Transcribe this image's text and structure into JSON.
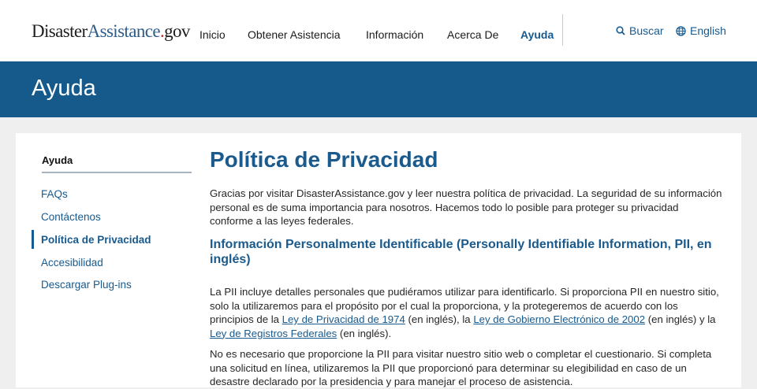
{
  "header": {
    "logo": {
      "part1": "Disaster",
      "part2": "Assistance",
      "dot": ".",
      "part3": "gov"
    },
    "nav": [
      "Inicio",
      "Obtener Asistencia",
      "Información",
      "Acerca De",
      "Ayuda"
    ],
    "active_nav": "Ayuda",
    "search_label": "Buscar",
    "language_label": "English"
  },
  "banner": {
    "title": "Ayuda"
  },
  "sidebar": {
    "heading": "Ayuda",
    "items": [
      "FAQs",
      "Contáctenos",
      "Política de Privacidad",
      "Accesibilidad",
      "Descargar Plug-ins"
    ],
    "current": "Política de Privacidad"
  },
  "main": {
    "title": "Política de Privacidad",
    "intro": "Gracias por visitar DisasterAssistance.gov y leer nuestra política de privacidad. La seguridad de su información personal es de suma importancia para nosotros. Hacemos todo lo posible para proteger su privacidad conforme a las leyes federales.",
    "section_heading": "Información Personalmente Identificable (Personally Identifiable Information, PII, en inglés)",
    "pii_text_1": "La PII incluye detalles personales que pudiéramos utilizar para identificarlo. Si proporciona PII en nuestro sitio, solo la utilizaremos para el propósito por el cual la proporciona, y la protegeremos de acuerdo con los principios de la ",
    "link_1": "Ley de Privacidad de 1974",
    "pii_text_2": " (en inglés), la ",
    "link_2": "Ley de Gobierno Electrónico de 2002",
    "pii_text_3": " (en inglés) y la ",
    "link_3": "Ley de Registros Federales",
    "pii_text_4": " (en inglés).",
    "para_2": "No es necesario que proporcione la PII para visitar nuestro sitio web o completar el cuestionario. Si completa una solicitud en línea, utilizaremos la PII que proporcionó para determinar su elegibilidad en caso de un desastre declarado por la presidencia y para manejar el proceso de asistencia."
  },
  "colors": {
    "brand_blue": "#155a8a",
    "link_blue": "#175a8f",
    "logo_red": "#c1272d"
  },
  "icons": {
    "search": "search-icon",
    "language": "globe-icon"
  }
}
